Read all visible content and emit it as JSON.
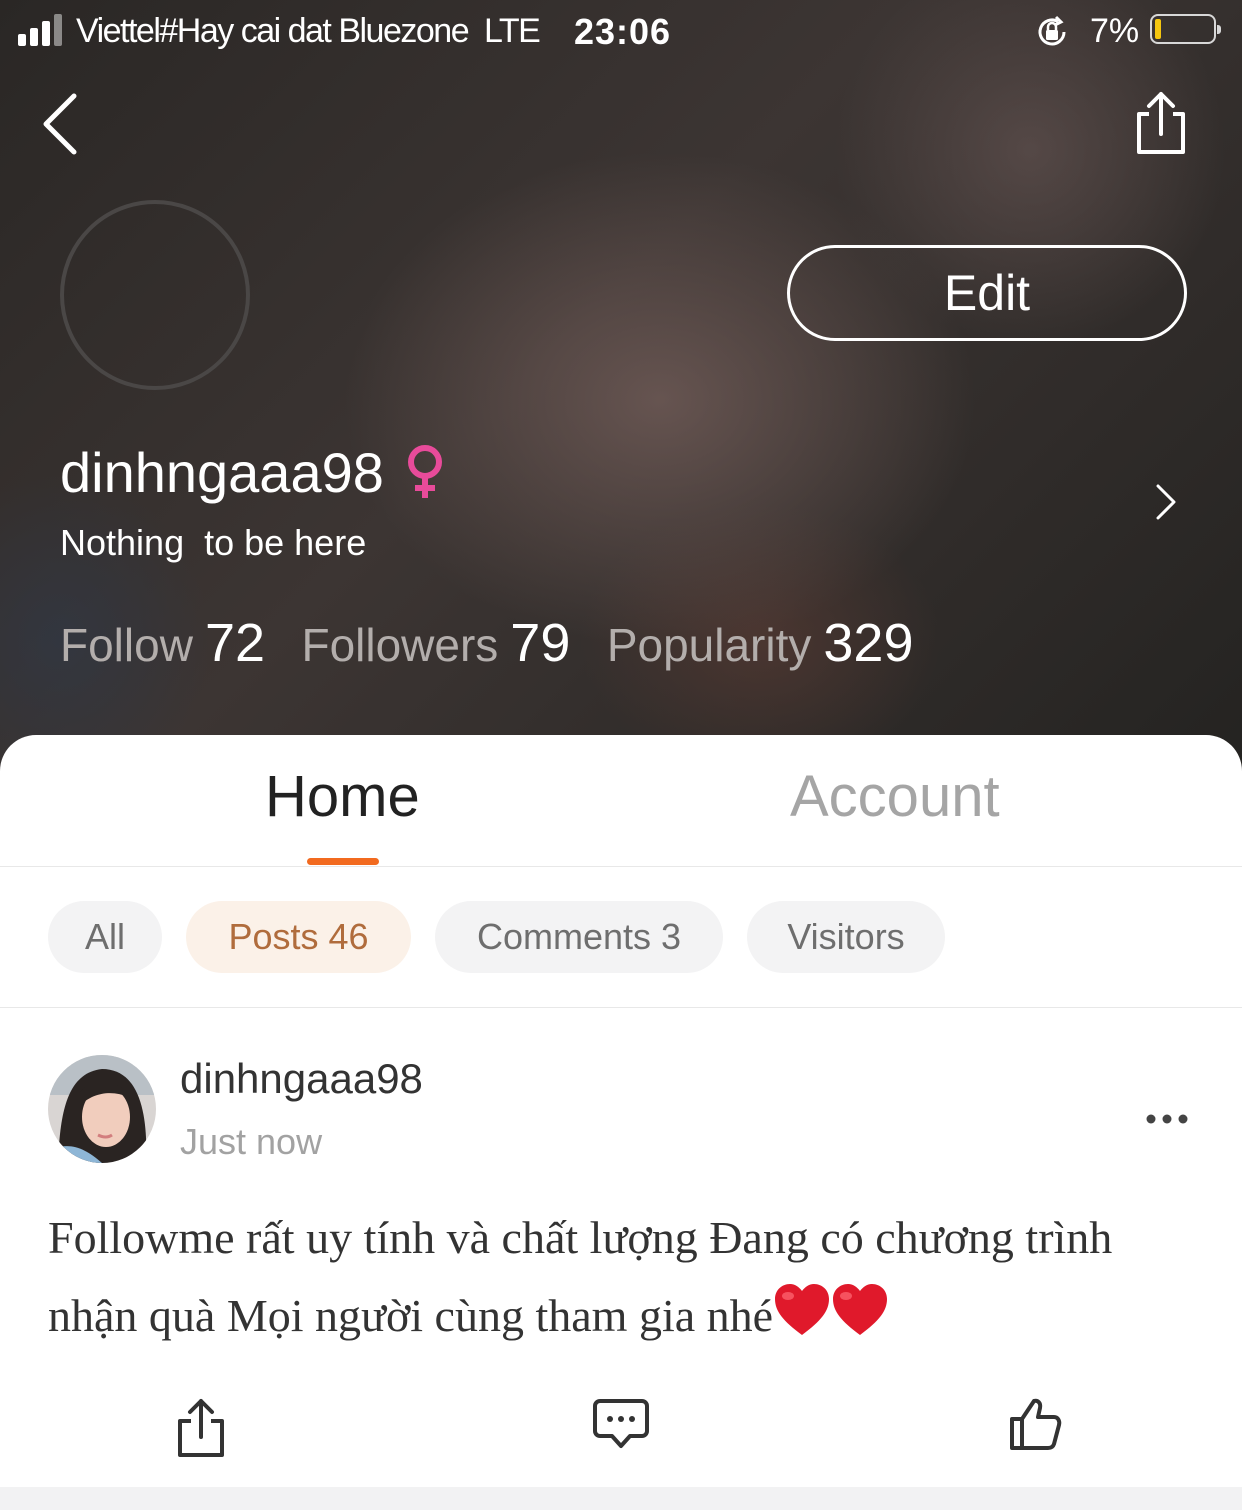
{
  "status_bar": {
    "carrier": "Viettel#Hay cai dat Bluezone",
    "network": "LTE",
    "time": "23:06",
    "battery_percent": "7%",
    "battery_level": 0.07,
    "battery_color": "#f5c60f"
  },
  "profile": {
    "edit_label": "Edit",
    "username": "dinhngaaa98",
    "gender_icon": "female-symbol-icon",
    "gender_color": "#e84b9a",
    "bio": "Nothing  to be here",
    "stats": [
      {
        "label": "Follow",
        "value": "72"
      },
      {
        "label": "Followers",
        "value": "79"
      },
      {
        "label": "Popularity",
        "value": "329"
      }
    ]
  },
  "tabs": {
    "home": "Home",
    "account": "Account",
    "active": "Home",
    "accent_color": "#f26a1f"
  },
  "filters": [
    {
      "label": "All"
    },
    {
      "label": "Posts 46",
      "active": true
    },
    {
      "label": "Comments 3"
    },
    {
      "label": "Visitors"
    }
  ],
  "post": {
    "author": "dinhngaaa98",
    "time": "Just now",
    "text": "Followme rất uy tính và chất lượng Đang có chương trình nhận quà Mọi người cùng tham gia nhé",
    "emoji": [
      "heart-emoji",
      "heart-emoji"
    ]
  },
  "actions": [
    "share-icon",
    "comment-icon",
    "like-icon"
  ]
}
